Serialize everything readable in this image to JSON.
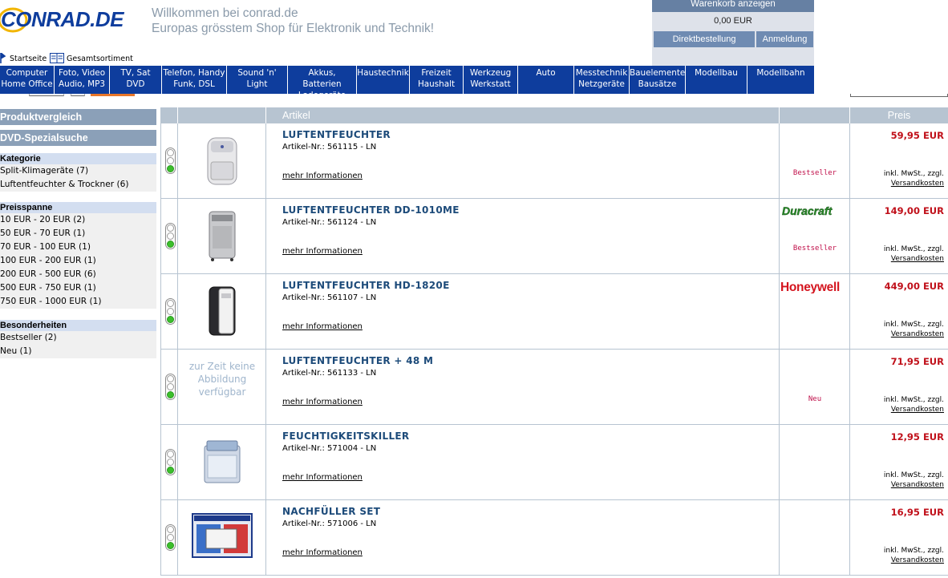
{
  "header": {
    "logo_text": "CONRAD.DE",
    "welcome_line1": "Willkommen bei conrad.de",
    "welcome_line2": "Europas grösstem Shop für Elektronik und Technik!"
  },
  "cart": {
    "title": "Warenkorb anzeigen",
    "total": "0,00 EUR",
    "quick_order": "Direktbestellung",
    "login": "Anmeldung"
  },
  "crumbs": {
    "home": "Startseite",
    "catalog": "Gesamtsortiment"
  },
  "nav": [
    "Computer\nHome Office",
    "Foto, Video\nAudio, MP3",
    "TV, Sat\nDVD",
    "Telefon, Handy\nFunk, DSL",
    "Sound 'n' Light",
    "Akkus, Batterien\nLadegeräte",
    "Haustechnik",
    "Freizeit\nHaushalt",
    "Werkzeug\nWerkstatt",
    "Auto",
    "Messtechnik\nNetzgeräte",
    "Bauelemente\nBausätze",
    "Modellbau",
    "Modellbahn"
  ],
  "sidebar": {
    "compare": "Produktvergleich",
    "dvd_search": "DVD-Spezialsuche",
    "category_head": "Kategorie",
    "categories": [
      "Split-Klimageräte (7)",
      "Luftentfeuchter & Trockner (6)"
    ],
    "price_head": "Preisspanne",
    "prices": [
      "10 EUR - 20 EUR (2)",
      "50 EUR - 70 EUR (1)",
      "70 EUR - 100 EUR (1)",
      "100 EUR - 200 EUR (1)",
      "200 EUR - 500 EUR (6)",
      "500 EUR - 750 EUR (1)",
      "750 EUR - 1000 EUR (1)"
    ],
    "special_head": "Besonderheiten",
    "specials": [
      "Bestseller (2)",
      "Neu (1)"
    ]
  },
  "table": {
    "col_article": "Artikel",
    "col_price": "Preis",
    "more_label": "mehr Informationen",
    "tax_label": "inkl. MwSt., zzgl.",
    "shipping_label": "Versandkosten",
    "noimg_text": "zur Zeit keine Abbildung verfügbar",
    "rows": [
      {
        "title": "LUFTENTFEUCHTER",
        "article": "Artikel-Nr.:  561115 - LN",
        "badge": "Bestseller",
        "brand": "",
        "price": "59,95 EUR",
        "image": "dehumidifier-small"
      },
      {
        "title": "LUFTENTFEUCHTER DD-1010ME",
        "article": "Artikel-Nr.:  561124 - LN",
        "badge": "Bestseller",
        "brand": "Duracraft",
        "price": "149,00  EUR",
        "image": "dehumidifier-tall"
      },
      {
        "title": "LUFTENTFEUCHTER HD-1820E",
        "article": "Artikel-Nr.:  561107 - LN",
        "badge": "",
        "brand": "Honeywell",
        "price": "449,00  EUR",
        "image": "dehumidifier-black"
      },
      {
        "title": "LUFTENTFEUCHTER + 48 M",
        "article": "Artikel-Nr.:  561133 - LN",
        "badge": "Neu",
        "brand": "",
        "price": "71,95 EUR",
        "image": "none"
      },
      {
        "title": "FEUCHTIGKEITSKILLER",
        "article": "Artikel-Nr.:  571004 - LN",
        "badge": "",
        "brand": "",
        "price": "12,95 EUR",
        "image": "moisture-box"
      },
      {
        "title": "NACHFÜLLER SET",
        "article": "Artikel-Nr.:  571006 - LN",
        "badge": "",
        "brand": "",
        "price": "16,95 EUR",
        "image": "refill-pack"
      }
    ]
  },
  "colors": {
    "nav_bg": "#0e3d9d",
    "sidebar_bar": "#8ba0b8",
    "filter_head": "#d3def0",
    "price_red": "#c0101a",
    "badge_red": "#c0104a",
    "title_blue": "#1d4b7a"
  }
}
